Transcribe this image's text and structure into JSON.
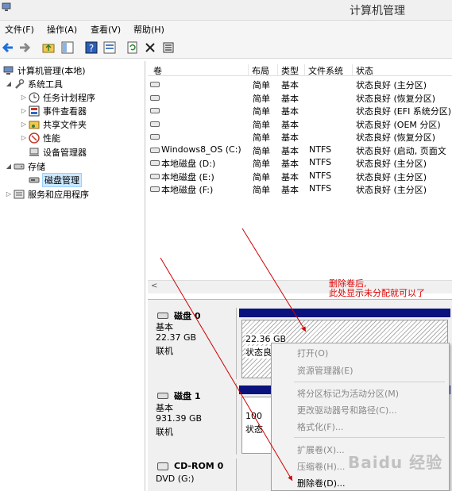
{
  "window": {
    "title": "计算机管理"
  },
  "menu": [
    "文件(F)",
    "操作(A)",
    "查看(V)",
    "帮助(H)"
  ],
  "tree": [
    {
      "label": "计算机管理(本地)",
      "level": 0,
      "expanded": true,
      "icon": "computer-icon"
    },
    {
      "label": "系统工具",
      "level": 1,
      "expanded": true,
      "icon": "tools-icon"
    },
    {
      "label": "任务计划程序",
      "level": 2,
      "expanded": false,
      "icon": "clock-icon"
    },
    {
      "label": "事件查看器",
      "level": 2,
      "expanded": false,
      "icon": "event-viewer-icon"
    },
    {
      "label": "共享文件夹",
      "level": 2,
      "expanded": false,
      "icon": "shared-folder-icon"
    },
    {
      "label": "性能",
      "level": 2,
      "expanded": false,
      "icon": "performance-icon"
    },
    {
      "label": "设备管理器",
      "level": 2,
      "expanded": null,
      "icon": "device-manager-icon"
    },
    {
      "label": "存储",
      "level": 1,
      "expanded": true,
      "icon": "storage-icon"
    },
    {
      "label": "磁盘管理",
      "level": 2,
      "expanded": null,
      "icon": "disk-management-icon",
      "selected": true
    },
    {
      "label": "服务和应用程序",
      "level": 1,
      "expanded": false,
      "icon": "services-icon"
    }
  ],
  "volume_table": {
    "headers": [
      "卷",
      "布局",
      "类型",
      "文件系统",
      "状态"
    ],
    "rows": [
      {
        "name": "",
        "layout": "简单",
        "type": "基本",
        "fs": "",
        "status": "状态良好 (主分区)"
      },
      {
        "name": "",
        "layout": "简单",
        "type": "基本",
        "fs": "",
        "status": "状态良好 (恢复分区)"
      },
      {
        "name": "",
        "layout": "简单",
        "type": "基本",
        "fs": "",
        "status": "状态良好 (EFI 系统分区)"
      },
      {
        "name": "",
        "layout": "简单",
        "type": "基本",
        "fs": "",
        "status": "状态良好 (OEM 分区)"
      },
      {
        "name": "",
        "layout": "简单",
        "type": "基本",
        "fs": "",
        "status": "状态良好 (恢复分区)"
      },
      {
        "name": "Windows8_OS (C:)",
        "layout": "简单",
        "type": "基本",
        "fs": "NTFS",
        "status": "状态良好 (启动, 页面文"
      },
      {
        "name": "本地磁盘 (D:)",
        "layout": "简单",
        "type": "基本",
        "fs": "NTFS",
        "status": "状态良好 (主分区)"
      },
      {
        "name": "本地磁盘 (E:)",
        "layout": "简单",
        "type": "基本",
        "fs": "NTFS",
        "status": "状态良好 (主分区)"
      },
      {
        "name": "本地磁盘 (F:)",
        "layout": "简单",
        "type": "基本",
        "fs": "NTFS",
        "status": "状态良好 (主分区)"
      }
    ]
  },
  "disks": [
    {
      "name": "磁盘 0",
      "kind": "基本",
      "size": "22.37 GB",
      "state": "联机",
      "partition_size": "22.36 GB",
      "partition_status": "状态良"
    },
    {
      "name": "磁盘 1",
      "kind": "基本",
      "size": "931.39 GB",
      "state": "联机",
      "partition_size": "100",
      "partition_status": "状态"
    },
    {
      "name": "CD-ROM 0",
      "kind": "DVD (G:)",
      "size": "",
      "state": "",
      "partition_size": "",
      "partition_status": ""
    }
  ],
  "context_menu": [
    {
      "label": "打开(O)",
      "disabled": true
    },
    {
      "label": "资源管理器(E)",
      "disabled": true
    },
    {
      "sep": true
    },
    {
      "label": "将分区标记为活动分区(M)",
      "disabled": true
    },
    {
      "label": "更改驱动器号和路径(C)...",
      "disabled": true
    },
    {
      "label": "格式化(F)...",
      "disabled": true
    },
    {
      "sep": true
    },
    {
      "label": "扩展卷(X)...",
      "disabled": true
    },
    {
      "label": "压缩卷(H)...",
      "disabled": true
    },
    {
      "label": "删除卷(D)...",
      "disabled": false
    }
  ],
  "annotation": [
    "删除卷后,",
    "此处显示未分配就可以了"
  ],
  "watermark": "Baidu 经验",
  "colors": {
    "disk_bar": "#0a127d",
    "annotation": "#e00000",
    "selection": "#cce8ff"
  }
}
